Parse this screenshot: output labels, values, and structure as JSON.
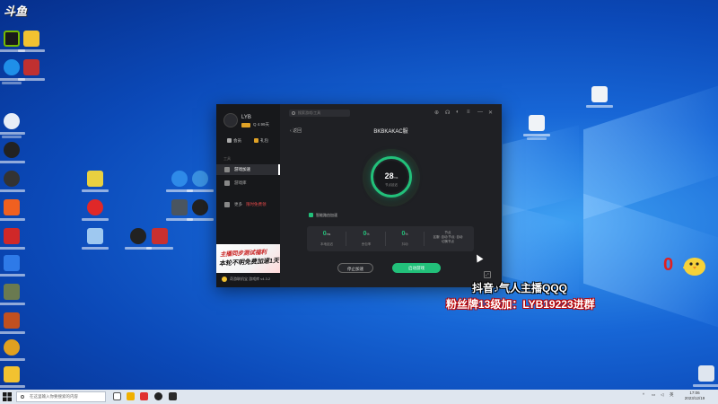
{
  "desktop": {
    "top_left_logo": "斗鱼",
    "overlay": {
      "line1": "抖音♪气人主播QQQ",
      "line2": "粉丝牌13级加：LYB19223进群",
      "counter": "0"
    },
    "colors": {
      "accent": "#22c07a",
      "desktop_bg": "#0b49b8"
    }
  },
  "app": {
    "user": {
      "name": "LYB",
      "vip_badge": "VIP",
      "vip_text": "Q 4.99天"
    },
    "side_buttons": [
      {
        "label": "会员"
      },
      {
        "label": "礼包"
      }
    ],
    "section_label": "工具",
    "nav": [
      {
        "label": "游戏加速",
        "active": true
      },
      {
        "label": "游戏库",
        "active": false
      },
      {
        "label": "更多",
        "badge": "限时免费领",
        "active": false
      }
    ],
    "banner": {
      "line1": "主播同步测试福利",
      "line2": "本轮不明免费加速1天"
    },
    "footer": {
      "label": "奇游联机宝 游戏库",
      "version": "v4.3.2"
    },
    "search_placeholder": "搜索游戏/工具",
    "back_label": "返回",
    "game_title": "BKBKAKAC服",
    "latency": {
      "value": "28",
      "unit": "ms",
      "label": "节点延迟"
    },
    "checkbox_label": "智能路由加速",
    "stats": [
      {
        "value": "0",
        "unit": "ms",
        "label": "本地延迟"
      },
      {
        "value": "0",
        "unit": "%",
        "label": "丢包率"
      },
      {
        "value": "0",
        "unit": "%",
        "label": "抖动"
      }
    ],
    "region": {
      "title": "节点",
      "detail": "区服: 自动 节点: 自动",
      "note": "切换节点"
    },
    "buttons": {
      "stop": "停止加速",
      "start": "启动游戏"
    }
  },
  "taskbar": {
    "search_placeholder": "在这里输入你要搜索的内容",
    "tray_text": "英",
    "time": "17:06",
    "date": "2023/12/19"
  }
}
